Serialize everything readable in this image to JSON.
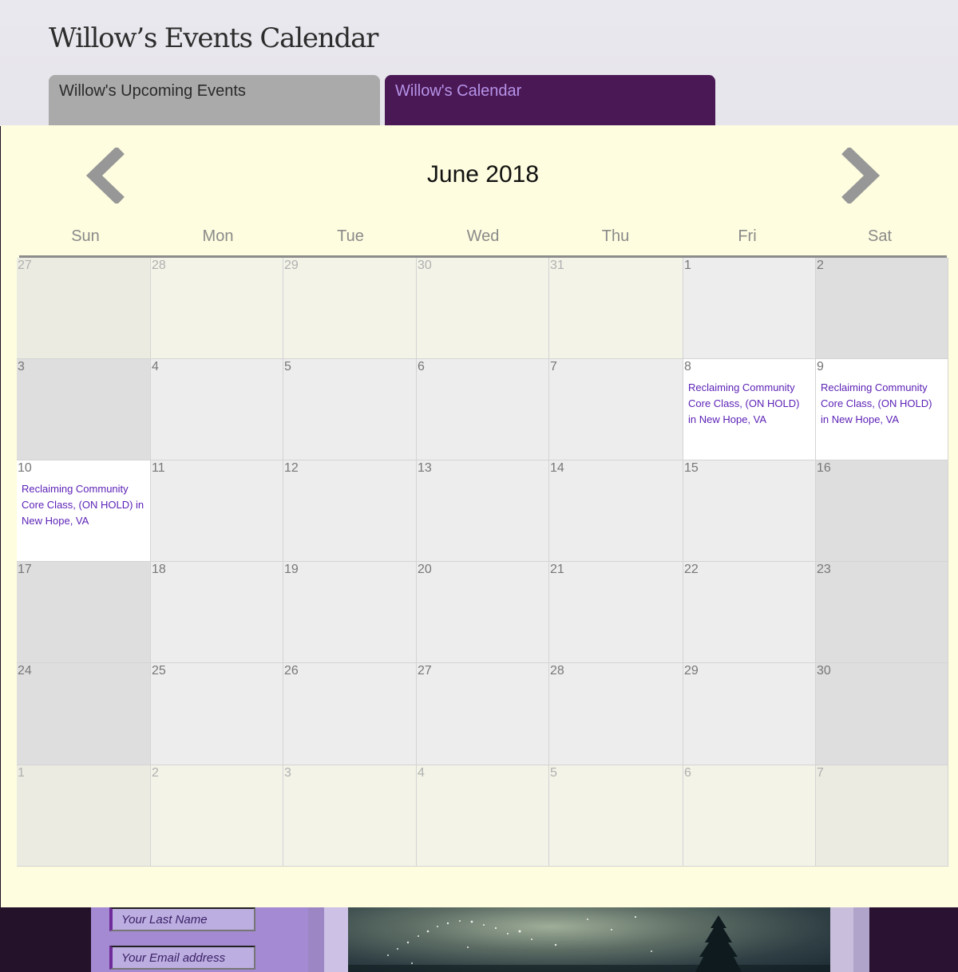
{
  "site": {
    "title": "Willow’s Events Calendar"
  },
  "tabs": [
    {
      "label": "Willow's Upcoming Events",
      "active": false
    },
    {
      "label": "Willow's Calendar",
      "active": true
    }
  ],
  "calendar": {
    "month_title": "June 2018",
    "prev_icon": "chevron-left-icon",
    "next_icon": "chevron-right-icon",
    "weekdays": [
      "Sun",
      "Mon",
      "Tue",
      "Wed",
      "Thu",
      "Fri",
      "Sat"
    ],
    "weeks": [
      [
        {
          "day": "27",
          "other": true
        },
        {
          "day": "28",
          "other": true
        },
        {
          "day": "29",
          "other": true
        },
        {
          "day": "30",
          "other": true
        },
        {
          "day": "31",
          "other": true
        },
        {
          "day": "1"
        },
        {
          "day": "2"
        }
      ],
      [
        {
          "day": "3"
        },
        {
          "day": "4"
        },
        {
          "day": "5"
        },
        {
          "day": "6"
        },
        {
          "day": "7"
        },
        {
          "day": "8",
          "event": "Reclaiming Community Core Class, (ON HOLD) in New Hope, VA"
        },
        {
          "day": "9",
          "event": "Reclaiming Community Core Class, (ON HOLD) in New Hope, VA"
        }
      ],
      [
        {
          "day": "10",
          "event": "Reclaiming Community Core Class, (ON HOLD) in New Hope, VA"
        },
        {
          "day": "11"
        },
        {
          "day": "12"
        },
        {
          "day": "13"
        },
        {
          "day": "14"
        },
        {
          "day": "15"
        },
        {
          "day": "16"
        }
      ],
      [
        {
          "day": "17"
        },
        {
          "day": "18"
        },
        {
          "day": "19"
        },
        {
          "day": "20"
        },
        {
          "day": "21"
        },
        {
          "day": "22"
        },
        {
          "day": "23"
        }
      ],
      [
        {
          "day": "24"
        },
        {
          "day": "25"
        },
        {
          "day": "26"
        },
        {
          "day": "27"
        },
        {
          "day": "28"
        },
        {
          "day": "29"
        },
        {
          "day": "30"
        }
      ],
      [
        {
          "day": "1",
          "other": true
        },
        {
          "day": "2",
          "other": true
        },
        {
          "day": "3",
          "other": true
        },
        {
          "day": "4",
          "other": true
        },
        {
          "day": "5",
          "other": true
        },
        {
          "day": "6",
          "other": true
        },
        {
          "day": "7",
          "other": true
        }
      ]
    ]
  },
  "signup": {
    "last_name_placeholder": "Your Last Name",
    "email_placeholder": "Your Email address"
  },
  "colors": {
    "active_tab_bg": "#4a1854",
    "active_tab_text": "#b693e9",
    "inactive_tab_bg": "#aaaaaa",
    "calendar_panel_bg": "#fefddf",
    "event_link": "#5a1fb5",
    "signup_panel": "#a48ad2"
  }
}
